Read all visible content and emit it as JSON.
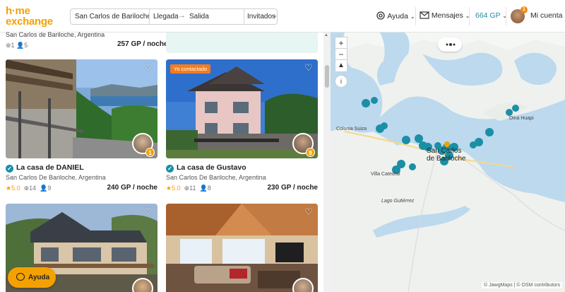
{
  "brand": {
    "logo_line1": "h·me",
    "logo_line2": "exchange",
    "accent": "#f4a100",
    "teal": "#1a8fa6"
  },
  "search": {
    "destination": "San Carlos de Bariloche, RN,",
    "checkin": "Llegada",
    "checkout": "Salida",
    "guests": "Invitados"
  },
  "nav": {
    "help": "Ayuda",
    "messages": "Mensajes",
    "points": "664 GP",
    "account": "Mi cuenta",
    "account_badge": "1"
  },
  "top_listing": {
    "city": "San Carlos de Bariloche, Argentina",
    "meta": "⊕1  👤5",
    "price": "257 GP / noche"
  },
  "listings": [
    {
      "title": "La casa de DANIEL",
      "city": "San Carlos De Bariloche, Argentina",
      "rating": "★5.0",
      "rooms": "14",
      "guests": "9",
      "price": "240 GP / noche",
      "badge": "1"
    },
    {
      "title": "La casa de Gustavo",
      "city": "San Carlos De Bariloche, Argentina",
      "rating": "★5.0",
      "rooms": "11",
      "guests": "8",
      "price": "230 GP / noche",
      "contacted": "Yo contactado",
      "badge": "9"
    },
    {
      "title": "",
      "city": "",
      "price": ""
    },
    {
      "title": "",
      "city": "",
      "price": ""
    }
  ],
  "help_button": "Ayuda",
  "map": {
    "labels": {
      "colonia_suiza": "Colonia Suiza",
      "villa_catedral": "Villa Catedral",
      "lago_gutierrez": "Lago Gutiérrez",
      "dina_huapi": "Dina Huapi",
      "city_line1": "San Carlos",
      "city_line2": "de Bariloche"
    },
    "attribution": "© JawgMaps | © OSM contributors"
  }
}
